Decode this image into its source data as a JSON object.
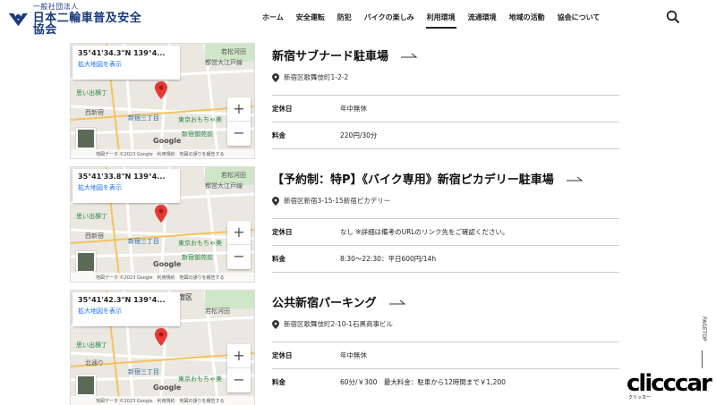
{
  "header": {
    "logo_sub": "一般社団法人",
    "logo_main": "日本二輪車普及安全協会",
    "nav": [
      "ホーム",
      "安全運転",
      "防犯",
      "バイクの楽しみ",
      "利用環境",
      "流通環境",
      "地域の活動",
      "協会について"
    ],
    "active_nav": "利用環境"
  },
  "map_common": {
    "enlarge_label": "拡大地図を表示",
    "zoom_in": "+",
    "zoom_out": "−",
    "google": "Google",
    "footer": "地図データ ©2023 Google　利用規約　地図の誤りを報告する",
    "labels": [
      "思い出横丁",
      "西新宿",
      "新宿三丁目",
      "東京おもちゃ美",
      "新宿御苑前",
      "若松河田",
      "都営大江戸線",
      "北通り"
    ]
  },
  "listings": [
    {
      "coords": "35°41'34.3\"N 139°4...",
      "title": "新宿サブナード駐車場",
      "address": "新宿区歌舞伎町1-2-2",
      "rows": [
        {
          "key": "定休日",
          "value": "年中無休"
        },
        {
          "key": "料金",
          "value": "220円/30分"
        }
      ]
    },
    {
      "coords": "35°41'33.8\"N 139°4...",
      "title": "【予約制：特P】《バイク専用》新宿ピカデリー駐車場",
      "address": "新宿区新宿3-15-15新宿ピカデリー",
      "rows": [
        {
          "key": "定休日",
          "value": "なし ※詳細は備考のURLのリンク先をご確認ください。"
        },
        {
          "key": "料金",
          "value": "8:30〜22:30：平日600円/14h"
        }
      ]
    },
    {
      "coords": "35°41'42.3\"N 139°4...",
      "title": "公共新宿パーキング",
      "address": "新宿区歌舞伎町2-10-1石黒商事ビル",
      "map_heading": "新宿区",
      "rows": [
        {
          "key": "定休日",
          "value": "年中無休"
        },
        {
          "key": "料金",
          "value": "60分/￥300　最大料金：駐車から12時間まで￥1,200"
        }
      ]
    }
  ],
  "page_top": "PAGETOP",
  "brand": {
    "name": "clicccar",
    "sub": "クリッカー"
  }
}
